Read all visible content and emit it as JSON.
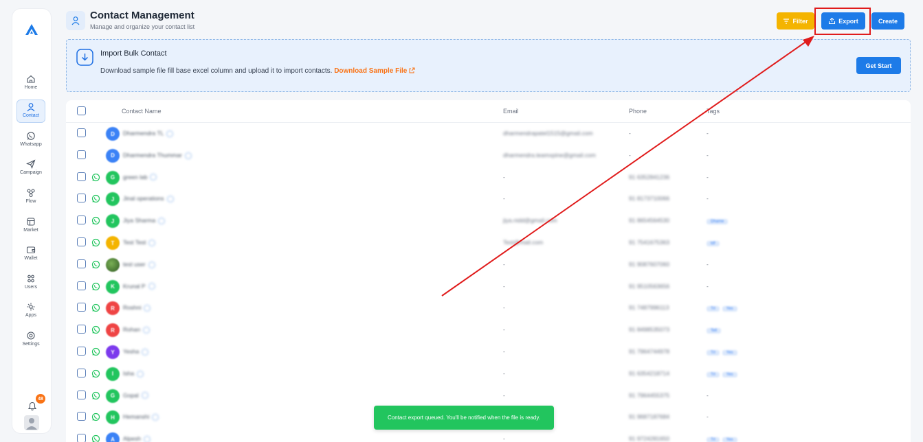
{
  "sidebar": {
    "items": [
      {
        "label": "Home",
        "icon": "home-icon"
      },
      {
        "label": "Contact",
        "icon": "contact-icon",
        "active": true
      },
      {
        "label": "Whatsapp",
        "icon": "whatsapp-icon"
      },
      {
        "label": "Campaign",
        "icon": "send-icon"
      },
      {
        "label": "Flow",
        "icon": "flow-icon"
      },
      {
        "label": "Market",
        "icon": "market-icon"
      },
      {
        "label": "Wallet",
        "icon": "wallet-icon"
      },
      {
        "label": "Users",
        "icon": "users-icon"
      },
      {
        "label": "Apps",
        "icon": "apps-icon"
      },
      {
        "label": "Settings",
        "icon": "settings-icon"
      }
    ],
    "notification_count": "48"
  },
  "header": {
    "title": "Contact Management",
    "subtitle": "Manage and organize your contact list",
    "filter_label": "Filter",
    "export_label": "Export",
    "create_label": "Create"
  },
  "import": {
    "title": "Import Bulk Contact",
    "description": "Download sample file fill base excel column and upload it to import contacts.",
    "link_label": "Download Sample File",
    "get_start_label": "Get Start"
  },
  "table": {
    "columns": {
      "name": "Contact Name",
      "email": "Email",
      "phone": "Phone",
      "tags": "Tags"
    },
    "rows": [
      {
        "initial": "D",
        "color": "#3b82f6",
        "name": "Dharmendra TL",
        "email": "dharmendrapatel1515@gmail.com",
        "phone": "-",
        "tags": [],
        "tags_text": "-",
        "whatsapp": false
      },
      {
        "initial": "D",
        "color": "#3b82f6",
        "name": "Dharmendra Thummar",
        "email": "dharmendra.teamxpine@gmail.com",
        "phone": "-",
        "tags": [],
        "tags_text": "-",
        "whatsapp": false
      },
      {
        "initial": "G",
        "color": "#22c55e",
        "name": "green lab",
        "email": "-",
        "phone": "91 6352841236",
        "tags": [],
        "tags_text": "-",
        "whatsapp": true
      },
      {
        "initial": "J",
        "color": "#22c55e",
        "name": "Jinal operations",
        "email": "-",
        "phone": "91 8173710066",
        "tags": [],
        "tags_text": "-",
        "whatsapp": true
      },
      {
        "initial": "J",
        "color": "#22c55e",
        "name": "Jiya Sharma",
        "email": "jiya.nidd@gmail.com",
        "phone": "91 8654564530",
        "tags": [
          "Dhame"
        ],
        "tags_text": "",
        "whatsapp": true
      },
      {
        "initial": "T",
        "color": "#f4b400",
        "name": "Test Test",
        "email": "Test@mail.com",
        "phone": "91 7541675363",
        "tags": [
          "tdf"
        ],
        "tags_text": "",
        "whatsapp": true
      },
      {
        "initial": "",
        "color": "#4b7a3a",
        "name": "test user",
        "email": "-",
        "phone": "91 9087607060",
        "tags": [],
        "tags_text": "-",
        "whatsapp": true
      },
      {
        "initial": "K",
        "color": "#22c55e",
        "name": "Krunal P",
        "email": "-",
        "phone": "91 9510563656",
        "tags": [],
        "tags_text": "-",
        "whatsapp": true
      },
      {
        "initial": "R",
        "color": "#ef4444",
        "name": "Roshni",
        "email": "-",
        "phone": "91 7487996113",
        "tags": [
          "Trl",
          "Yes"
        ],
        "tags_text": "",
        "whatsapp": true
      },
      {
        "initial": "R",
        "color": "#ef4444",
        "name": "Rohan",
        "email": "-",
        "phone": "91 8498535073",
        "tags": [
          "Tell"
        ],
        "tags_text": "",
        "whatsapp": true
      },
      {
        "initial": "Y",
        "color": "#7c3aed",
        "name": "Yesha",
        "email": "-",
        "phone": "91 7964744978",
        "tags": [
          "Trl",
          "Yes"
        ],
        "tags_text": "",
        "whatsapp": true
      },
      {
        "initial": "I",
        "color": "#22c55e",
        "name": "Isha",
        "email": "-",
        "phone": "91 6354218714",
        "tags": [
          "Trl",
          "Yes"
        ],
        "tags_text": "",
        "whatsapp": true
      },
      {
        "initial": "G",
        "color": "#22c55e",
        "name": "Gopal",
        "email": "-",
        "phone": "91 7964455375",
        "tags": [],
        "tags_text": "-",
        "whatsapp": true
      },
      {
        "initial": "H",
        "color": "#22c55e",
        "name": "Hemanshi",
        "email": "-",
        "phone": "91 9687187684",
        "tags": [],
        "tags_text": "-",
        "whatsapp": true
      },
      {
        "initial": "A",
        "color": "#3b82f6",
        "name": "Alpesh",
        "email": "-",
        "phone": "91 9724281650",
        "tags": [
          "Trl",
          "Yes"
        ],
        "tags_text": "",
        "whatsapp": true
      }
    ]
  },
  "toast": {
    "message": "Contact export queued. You'll be notified when the file is ready."
  },
  "colors": {
    "primary": "#1d7be8",
    "filter": "#f4b400",
    "annotation": "#e01b1b",
    "toast": "#22c55e",
    "link": "#f97316"
  }
}
